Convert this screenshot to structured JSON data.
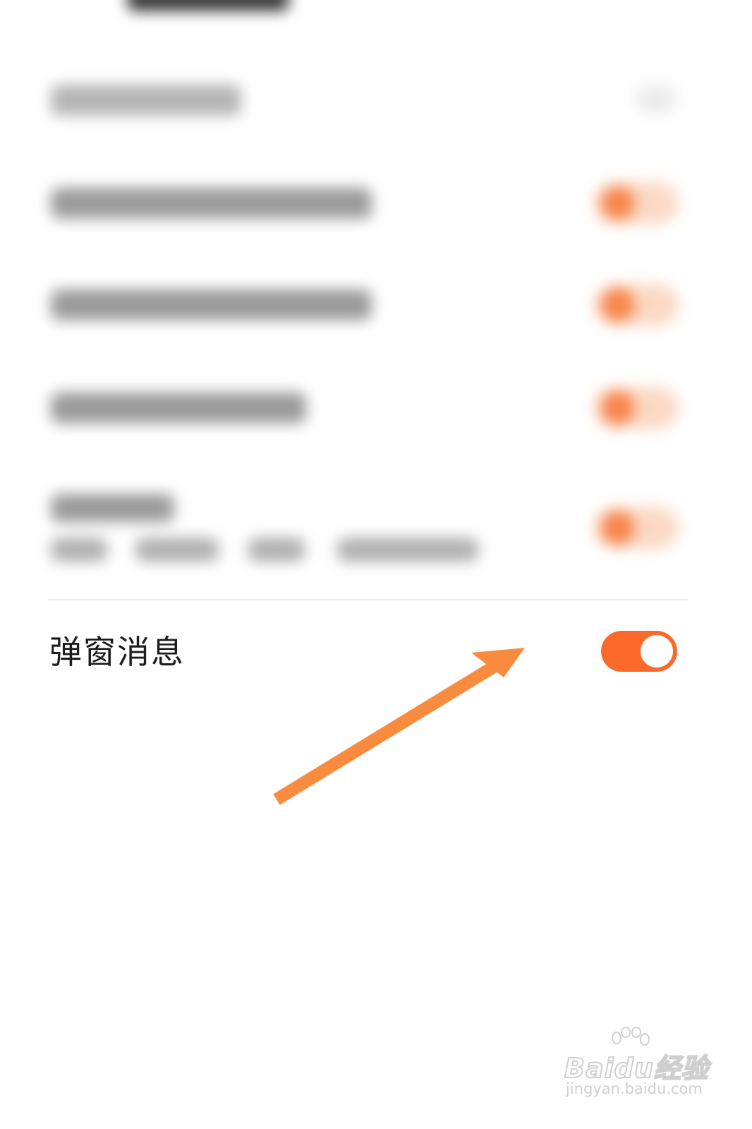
{
  "settings": {
    "popup_message": {
      "label": "弹窗消息",
      "enabled": true
    }
  },
  "colors": {
    "accent": "#fb6a2a",
    "arrow": "#f98b3f"
  },
  "icons": {
    "annotation": "arrow-up-right-icon"
  },
  "watermark": {
    "brand": "Baidu经验",
    "url": "jingyan.baidu.com"
  }
}
